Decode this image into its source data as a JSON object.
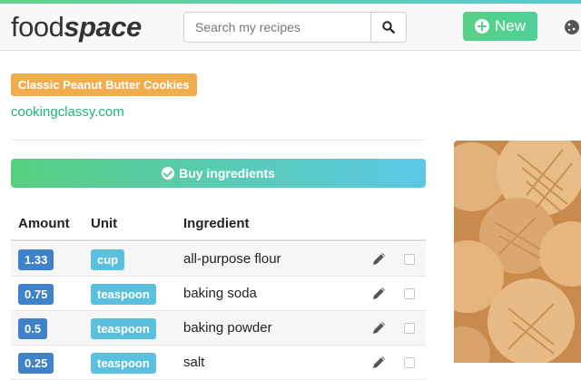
{
  "header": {
    "logo_part1": "food",
    "logo_part2": "space",
    "search_placeholder": "Search my recipes",
    "new_label": "New"
  },
  "recipe": {
    "title": "Classic Peanut Butter Cookies",
    "source": "cookingclassy.com",
    "buy_label": "Buy ingredients"
  },
  "table": {
    "headers": {
      "amount": "Amount",
      "unit": "Unit",
      "ingredient": "Ingredient"
    },
    "rows": [
      {
        "amount": "1.33",
        "unit": "cup",
        "ingredient": "all-purpose flour"
      },
      {
        "amount": "0.75",
        "unit": "teaspoon",
        "ingredient": "baking soda"
      },
      {
        "amount": "0.5",
        "unit": "teaspoon",
        "ingredient": "baking powder"
      },
      {
        "amount": "0.25",
        "unit": "teaspoon",
        "ingredient": "salt"
      }
    ]
  },
  "colors": {
    "brand_green": "#58d184",
    "amount_badge": "#3f82c9",
    "unit_badge": "#5bc0de",
    "title_badge": "#f0ad4e",
    "source_link": "#1fb47a"
  },
  "icons": [
    "search-icon",
    "plus-circle-icon",
    "cookie-icon",
    "check-circle-icon",
    "pencil-icon"
  ]
}
